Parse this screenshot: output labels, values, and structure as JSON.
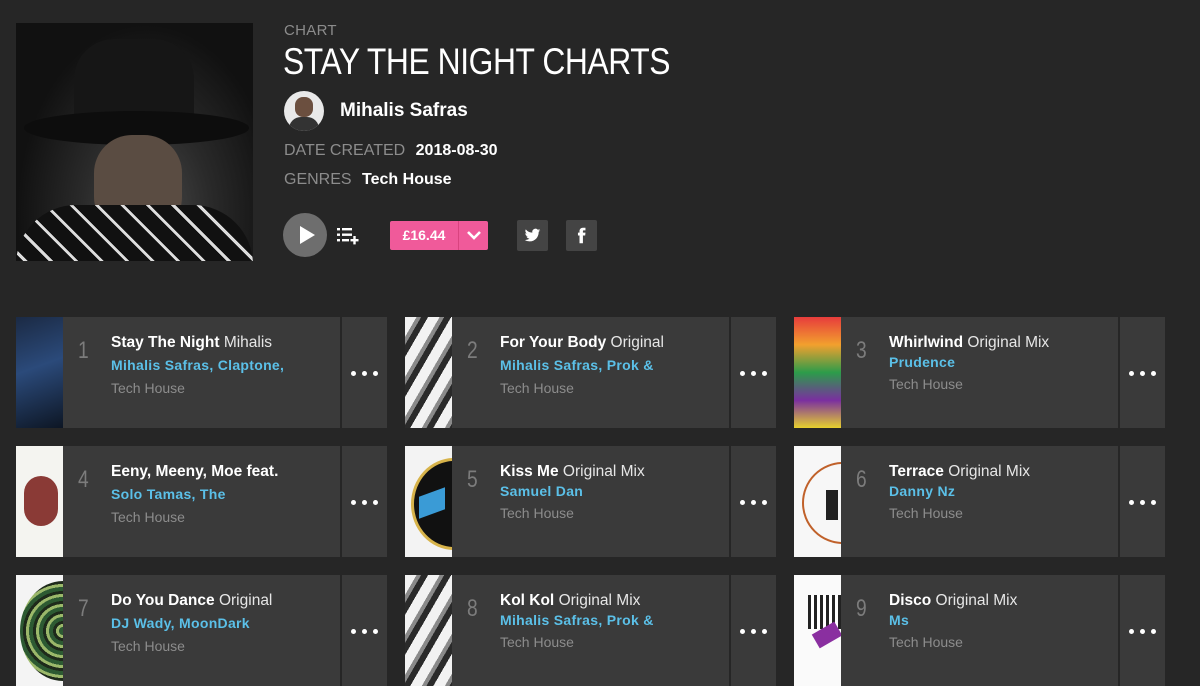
{
  "header": {
    "kicker": "CHART",
    "title": "STAY THE NIGHT CHARTS",
    "artist": "Mihalis Safras",
    "date_label": "DATE CREATED",
    "date_value": "2018-08-30",
    "genres_label": "GENRES",
    "genres_value": "Tech House",
    "price": "£16.44",
    "accent_color": "#f05a9a",
    "link_color": "#5bc0e8"
  },
  "icons": {
    "play": "play-icon",
    "queue": "add-to-queue-icon",
    "price_caret": "chevron-down-icon",
    "twitter": "twitter-icon",
    "facebook": "facebook-icon",
    "more": "more-options-icon"
  },
  "tracks": [
    {
      "num": "1",
      "title": "Stay The Night",
      "mix": "Mihalis",
      "artists": "Mihalis Safras, Claptone,",
      "genre": "Tech House"
    },
    {
      "num": "2",
      "title": "For Your Body",
      "mix": "Original",
      "artists": "Mihalis Safras, Prok &",
      "genre": "Tech House"
    },
    {
      "num": "3",
      "title": "Whirlwind",
      "mix": "Original Mix",
      "artists": "Prudence",
      "genre": "Tech House"
    },
    {
      "num": "4",
      "title": "Eeny, Meeny, Moe feat.",
      "mix": "",
      "artists": "Solo Tamas, The",
      "genre": "Tech House"
    },
    {
      "num": "5",
      "title": "Kiss Me",
      "mix": "Original Mix",
      "artists": "Samuel Dan",
      "genre": "Tech House"
    },
    {
      "num": "6",
      "title": "Terrace",
      "mix": "Original Mix",
      "artists": "Danny Nz",
      "genre": "Tech House"
    },
    {
      "num": "7",
      "title": "Do You Dance",
      "mix": "Original",
      "artists": "DJ Wady, MoonDark",
      "genre": "Tech House"
    },
    {
      "num": "8",
      "title": "Kol Kol",
      "mix": "Original Mix",
      "artists": "Mihalis Safras, Prok &",
      "genre": "Tech House"
    },
    {
      "num": "9",
      "title": "Disco",
      "mix": "Original Mix",
      "artists": "Ms",
      "genre": "Tech House"
    }
  ]
}
